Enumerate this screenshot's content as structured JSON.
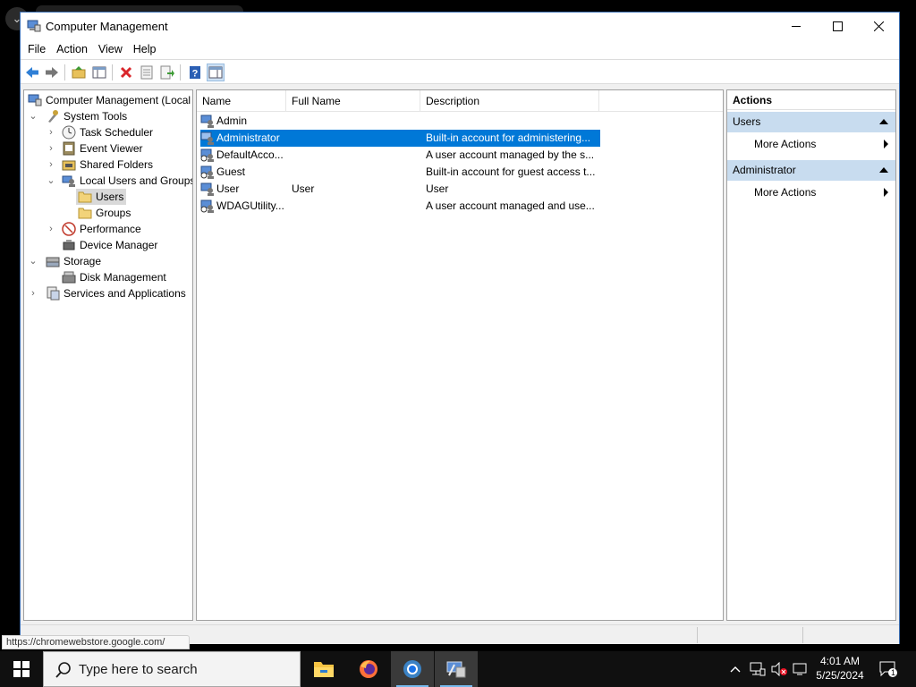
{
  "window": {
    "title": "Computer Management"
  },
  "menu": [
    "File",
    "Action",
    "View",
    "Help"
  ],
  "toolbar": {
    "buttons": [
      "back-icon",
      "forward-icon",
      "up-folder-icon",
      "show-hide-tree-icon",
      "delete-icon",
      "properties-icon",
      "export-list-icon",
      "help-icon",
      "show-hide-action-pane-icon"
    ]
  },
  "tree": {
    "root": "Computer Management (Local",
    "system_tools": "System Tools",
    "task_scheduler": "Task Scheduler",
    "event_viewer": "Event Viewer",
    "shared_folders": "Shared Folders",
    "local_users_groups": "Local Users and Groups",
    "users": "Users",
    "groups": "Groups",
    "performance": "Performance",
    "device_manager": "Device Manager",
    "storage": "Storage",
    "disk_management": "Disk Management",
    "services_apps": "Services and Applications"
  },
  "list": {
    "columns": [
      "Name",
      "Full Name",
      "Description"
    ],
    "rows": [
      {
        "name": "Admin",
        "full_name": "",
        "description": ""
      },
      {
        "name": "Administrator",
        "full_name": "",
        "description": "Built-in account for administering..."
      },
      {
        "name": "DefaultAcco...",
        "full_name": "",
        "description": "A user account managed by the s..."
      },
      {
        "name": "Guest",
        "full_name": "",
        "description": "Built-in account for guest access t..."
      },
      {
        "name": "User",
        "full_name": "User",
        "description": "User"
      },
      {
        "name": "WDAGUtility...",
        "full_name": "",
        "description": "A user account managed and use..."
      }
    ],
    "selected_row": "Administrator"
  },
  "actions": {
    "title": "Actions",
    "groups": [
      {
        "label": "Users",
        "item": "More Actions"
      },
      {
        "label": "Administrator",
        "item": "More Actions"
      }
    ]
  },
  "status_url": "https://chromewebstore.google.com/",
  "taskbar": {
    "search_placeholder": "Type here to search",
    "apps": [
      "file-explorer-icon",
      "firefox-icon",
      "chrome-icon",
      "computer-management-icon"
    ],
    "time": "4:01 AM",
    "date": "5/25/2024",
    "notification_count": "1"
  },
  "colors": {
    "selection": "#0078d7",
    "action_group": "#c8dcef",
    "taskbar": "#101010"
  }
}
